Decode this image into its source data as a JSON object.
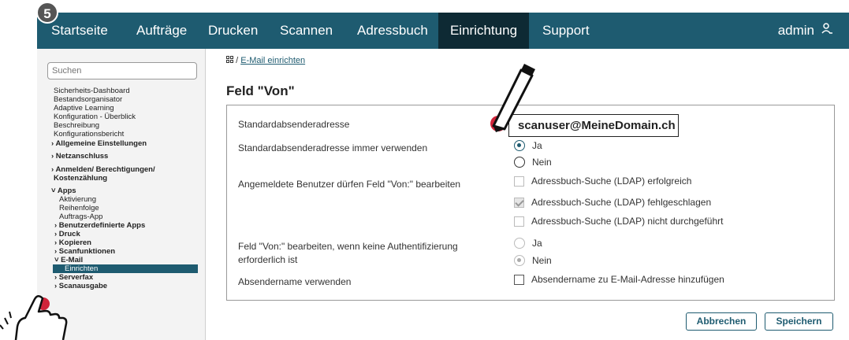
{
  "step_number": "5",
  "nav": {
    "tabs": [
      {
        "label": "Startseite"
      },
      {
        "label": "Aufträge"
      },
      {
        "label": "Drucken"
      },
      {
        "label": "Scannen"
      },
      {
        "label": "Adressbuch"
      },
      {
        "label": "Einrichtung",
        "active": true
      },
      {
        "label": "Support"
      }
    ],
    "user": "admin",
    "user_icon": "user-icon"
  },
  "sidebar": {
    "search_placeholder": "Suchen",
    "items": [
      "Sicherheits-Dashboard",
      "Bestandsorganisator",
      "Adaptive Learning",
      "Konfiguration - Überblick",
      "Beschreibung",
      "Konfigurationsbericht",
      "› Allgemeine Einstellungen",
      "› Netzanschluss",
      "› Anmelden/ Berechtigungen/",
      "Kostenzählung",
      "˅ Apps",
      "Aktivierung",
      "Reihenfolge",
      "Auftrags-App",
      "› Benutzerdefinierte Apps",
      "› Druck",
      "› Kopieren",
      "› Scanfunktionen",
      "˅ E-Mail",
      "Einrichten",
      "› Serverfax",
      "› Scanausgabe"
    ]
  },
  "breadcrumb": {
    "home_icon": "grid-icon",
    "separator": "/",
    "link": "E-Mail einrichten"
  },
  "page_title": "Feld \"Von\"",
  "form": {
    "default_sender_label": "Standardabsenderadresse",
    "default_sender_value": "scanuser@MeineDomain.ch",
    "always_use_label": "Standardabsenderadresse immer verwenden",
    "always_use_options": [
      "Ja",
      "Nein"
    ],
    "always_use_selected": "Ja",
    "edit_from_label": "Angemeldete Benutzer dürfen Feld \"Von:\" bearbeiten",
    "edit_from_options": [
      {
        "label": "Adressbuch-Suche (LDAP) erfolgreich",
        "checked": false
      },
      {
        "label": "Adressbuch-Suche (LDAP) fehlgeschlagen",
        "checked": true
      },
      {
        "label": "Adressbuch-Suche (LDAP) nicht durchgeführt",
        "checked": false
      }
    ],
    "no_auth_label_line1": "Feld \"Von:\" bearbeiten, wenn keine Authentifizierung",
    "no_auth_label_line2": "erforderlich ist",
    "no_auth_options": [
      "Ja",
      "Nein"
    ],
    "no_auth_selected": "Nein",
    "sender_name_label": "Absendername verwenden",
    "sender_name_option": "Absendername zu E-Mail-Adresse hinzufügen"
  },
  "buttons": {
    "cancel": "Abbrechen",
    "save": "Speichern"
  },
  "colors": {
    "nav_bg": "#1e5b70",
    "nav_active": "#0e2a34",
    "annotation_red": "#d0243a"
  }
}
